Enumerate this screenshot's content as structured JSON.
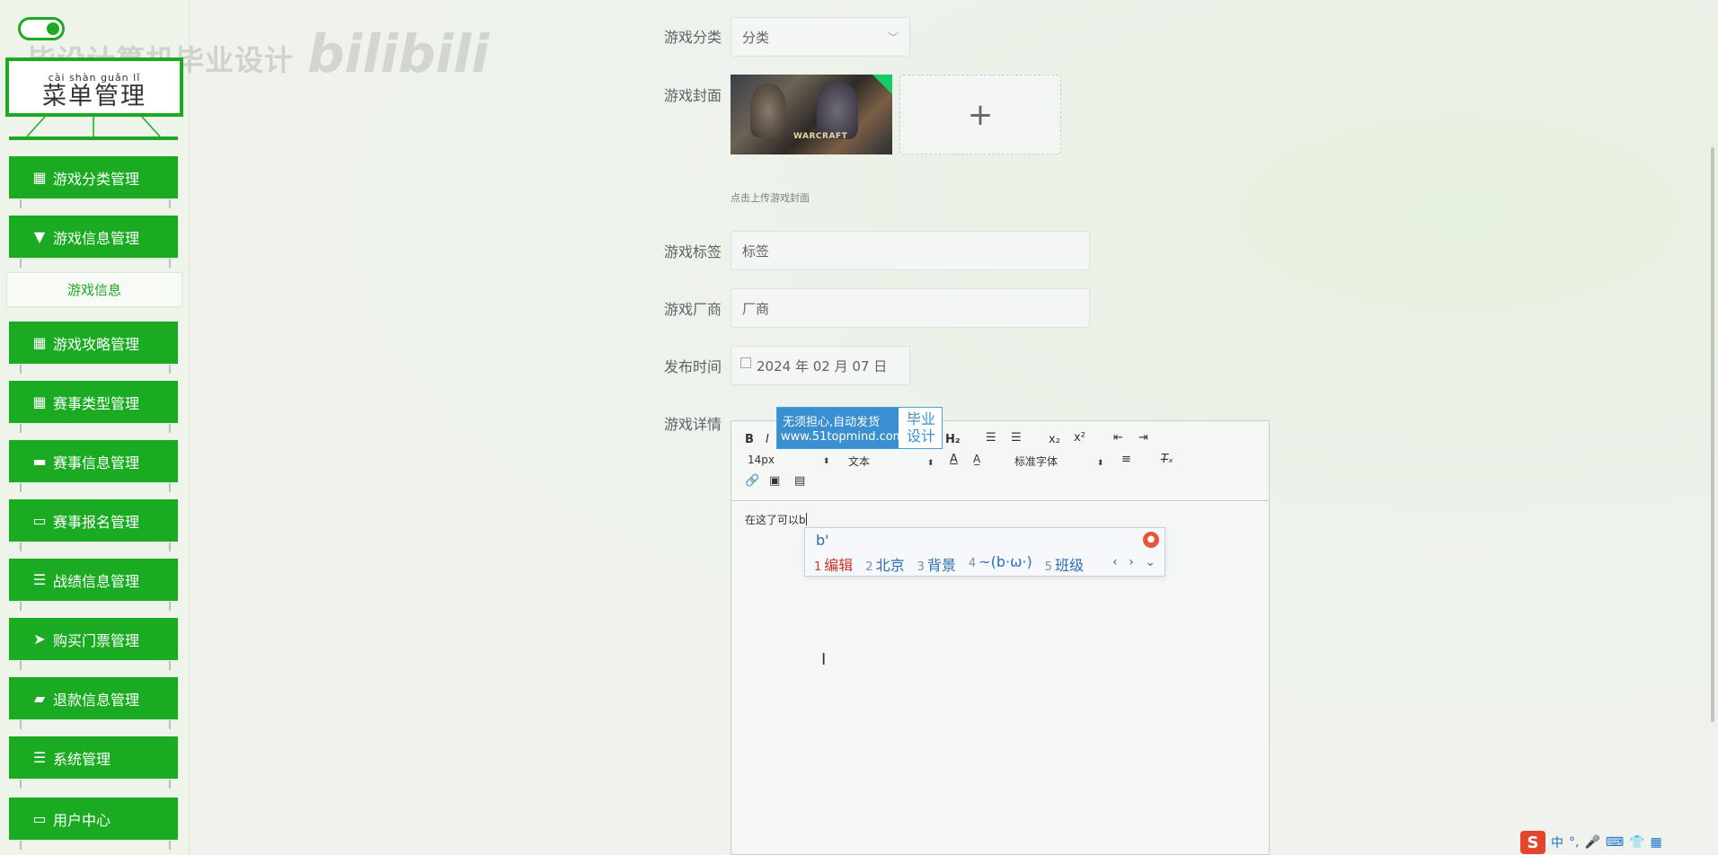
{
  "sidebar": {
    "watermark": "毕设计算机毕业设计",
    "watermark_logo": "bilibili",
    "title_pinyin": "cài  shàn  guǎn  lǐ",
    "title": "菜单管理",
    "items": [
      {
        "label": "游戏分类管理",
        "icon": "grid-icon"
      },
      {
        "label": "游戏信息管理",
        "icon": "pin-icon"
      },
      {
        "label": "游戏攻略管理",
        "icon": "grid-icon"
      },
      {
        "label": "赛事类型管理",
        "icon": "table-icon"
      },
      {
        "label": "赛事信息管理",
        "icon": "chat-icon"
      },
      {
        "label": "赛事报名管理",
        "icon": "monitor-icon"
      },
      {
        "label": "战绩信息管理",
        "icon": "sliders-icon"
      },
      {
        "label": "购买门票管理",
        "icon": "send-icon"
      },
      {
        "label": "退款信息管理",
        "icon": "ticket-icon"
      },
      {
        "label": "系统管理",
        "icon": "list-icon"
      },
      {
        "label": "用户中心",
        "icon": "card-icon"
      }
    ],
    "subitem": "游戏信息"
  },
  "form": {
    "category_label": "游戏分类",
    "category_value": "分类",
    "cover_label": "游戏封面",
    "cover_image_text": "WARCRAFT",
    "cover_hint": "点击上传游戏封面",
    "tag_label": "游戏标签",
    "tag_placeholder": "标签",
    "vendor_label": "游戏厂商",
    "vendor_placeholder": "厂商",
    "date_label": "发布时间",
    "date_value": "2024 年 02 月 07 日",
    "detail_label": "游戏详情"
  },
  "editor": {
    "font_size": "14px",
    "block_format": "文本",
    "font_family": "标准字体",
    "content": "在这了可以b"
  },
  "ad": {
    "line1": "无须担心,自动发货",
    "line2": "www.51topmind.com",
    "right": "毕业设计"
  },
  "ime": {
    "input": "b'",
    "candidates": [
      {
        "n": "1",
        "text": "编辑"
      },
      {
        "n": "2",
        "text": "北京"
      },
      {
        "n": "3",
        "text": "背景"
      },
      {
        "n": "4",
        "text": "~(b·ω·)"
      },
      {
        "n": "5",
        "text": "班级"
      }
    ]
  },
  "tray": {
    "ime_lang": "中"
  },
  "colors": {
    "accent": "#1aab23",
    "ime_blue": "#2b6fb5",
    "ad_blue": "#3a8fd0"
  }
}
